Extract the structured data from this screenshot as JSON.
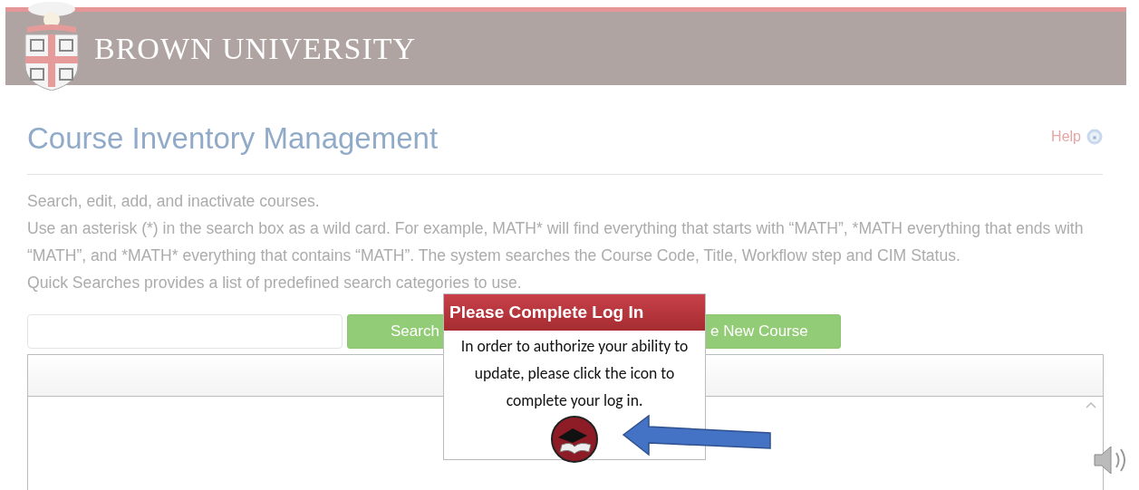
{
  "header": {
    "title": "BROWN UNIVERSITY"
  },
  "page": {
    "title": "Course Inventory Management",
    "help": "Help",
    "paragraphs": [
      "Search, edit, add, and inactivate courses.",
      "Use an asterisk (*) in the search box as a wild card. For example, MATH* will find everything that starts with “MATH”, *MATH everything that ends with “MATH”, and *MATH* everything that contains “MATH”. The system searches the Course Code, Title, Workflow step and CIM Status.",
      "Quick Searches provides a list of predefined search categories to use."
    ],
    "buttons": [
      "Search",
      "e New Course"
    ]
  },
  "popup": {
    "title": "Please Complete Log In",
    "message": "In order to authorize your ability to update, please click the icon to complete your log in."
  }
}
